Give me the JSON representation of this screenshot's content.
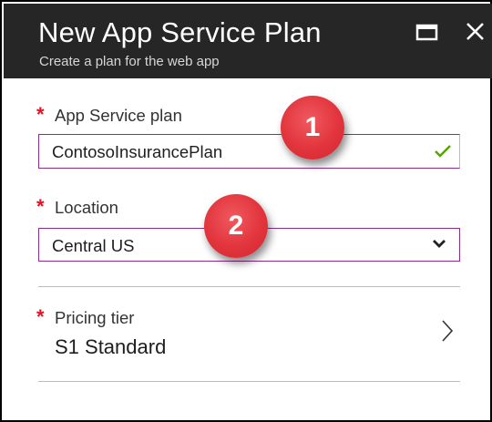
{
  "header": {
    "title": "New App Service Plan",
    "subtitle": "Create a plan for the web app",
    "maximize_icon": "maximize-icon",
    "close_icon": "close-icon"
  },
  "form": {
    "required_marker": "*",
    "app_service_plan": {
      "label": "App Service plan",
      "value": "ContosoInsurancePlan",
      "valid_icon": "check-icon"
    },
    "location": {
      "label": "Location",
      "value": "Central US",
      "dropdown_icon": "chevron-down-icon"
    },
    "pricing_tier": {
      "label": "Pricing tier",
      "value": "S1 Standard",
      "nav_icon": "chevron-right-icon"
    }
  },
  "callouts": [
    {
      "number": "1"
    },
    {
      "number": "2"
    }
  ],
  "colors": {
    "header_bg": "#262626",
    "required": "#e81123",
    "focus_border": "#8c2d8c",
    "valid_check": "#57a300",
    "callout": "#e2343d"
  }
}
